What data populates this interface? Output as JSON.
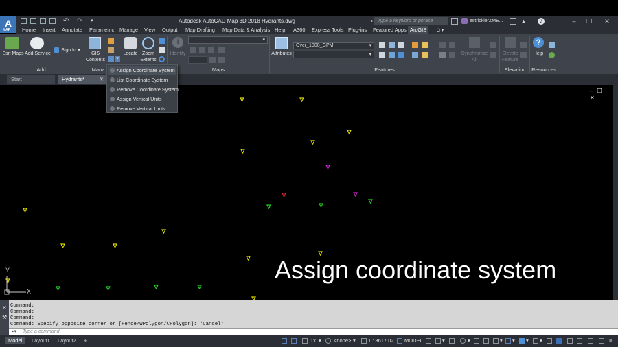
{
  "title_bar": {
    "app_letter": "A",
    "app_sub": "MAP",
    "title": "Autodesk AutoCAD Map 3D 2018   Hydrants.dwg",
    "search_placeholder": "Type a keyword or phrase",
    "user_name": "estricklerZME...",
    "window_controls": [
      "minimize-icon",
      "restore-icon",
      "close-icon"
    ]
  },
  "ribbon_tabs": [
    "Home",
    "Insert",
    "Annotate",
    "Parametric",
    "Manage",
    "View",
    "Output",
    "Map Drafting",
    "Map Data & Analysis",
    "Help",
    "A360",
    "Express Tools",
    "Plug-ins",
    "Featured Apps",
    "ArcGIS"
  ],
  "active_ribbon_tab": "ArcGIS",
  "ribbon": {
    "add_panel": {
      "label": "Add",
      "esri_maps": "Esri Maps",
      "add_service": "Add Service",
      "sign_in": "Sign In"
    },
    "manage_panel": {
      "label": "Mana",
      "gis_contents_line1": "GIS",
      "gis_contents_line2": "Contents",
      "locate": "Locate",
      "zoom_extents_line1": "Zoom",
      "zoom_extents_line2": "Extents"
    },
    "maps_panel": {
      "label": "Maps",
      "identify": "Identify"
    },
    "features_panel": {
      "label": "Features",
      "attributes": "Attributes",
      "layer_dropdown": "Over_1000_GPM",
      "synchronize_line1": "Synchronize",
      "synchronize_line2": "All",
      "elevate_line1": "Elevate",
      "elevate_line2": "Feature"
    },
    "elevation_panel": {
      "label": "Elevation"
    },
    "resources_panel": {
      "label": "Resources",
      "help": "Help"
    }
  },
  "coordinate_menu": {
    "items": [
      "Assign Coordinate System",
      "List Coordinate System",
      "Remove Coordinate System",
      "Assign Vertical Units",
      "Remove Vertical Units"
    ]
  },
  "doc_tabs": [
    "Start",
    "Hydrants*"
  ],
  "active_doc_tab": "Hydrants*",
  "canvas": {
    "caption": "Assign coordinate system",
    "ucs_y": "Y",
    "ucs_x": "X",
    "hydrant_colors": {
      "yellow": "#d4d400",
      "green": "#22cc22",
      "magenta": "#cc22cc",
      "red": "#dd2222"
    }
  },
  "command_line": {
    "history": [
      "Command:",
      "Command:",
      "Command:",
      "Command: Specify opposite corner or [Fence/WPolygon/CPolygon]: *Cancel*"
    ],
    "input_placeholder": "Type a command"
  },
  "status_bar": {
    "layout_tabs": [
      "Model",
      "Layout1",
      "Layout2"
    ],
    "active_layout": "Model",
    "add_layout": "+",
    "annotation_scale": "1x",
    "coordinate_system": "<none>",
    "map_scale": "1 : 3617.02",
    "space": "MODEL"
  }
}
